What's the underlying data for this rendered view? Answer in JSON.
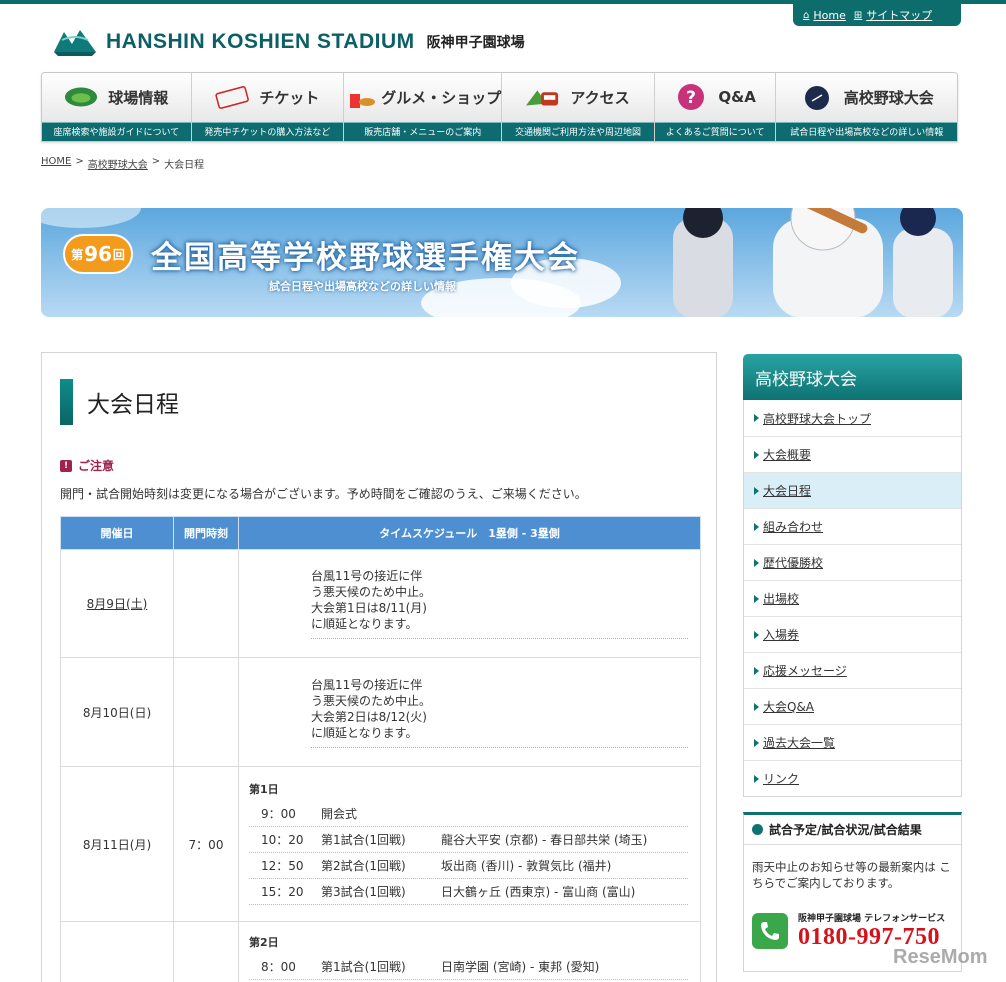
{
  "util": {
    "home": "Home",
    "sitemap": "サイトマップ"
  },
  "logo": {
    "en": "HANSHIN KOSHIEN STADIUM",
    "jp": "阪神甲子園球場"
  },
  "gnav": [
    {
      "label": "球場情報",
      "sub": "座席検索や施設ガイドについて"
    },
    {
      "label": "チケット",
      "sub": "発売中チケットの購入方法など"
    },
    {
      "label": "グルメ・ショップ",
      "sub": "販売店舗・メニューのご案内"
    },
    {
      "label": "アクセス",
      "sub": "交通機関ご利用方法や周辺地図"
    },
    {
      "label": "Q&A",
      "sub": "よくあるご質問について"
    },
    {
      "label": "高校野球大会",
      "sub": "試合日程や出場高校などの詳しい情報"
    }
  ],
  "breadcrumb": {
    "home": "HOME",
    "sep": ">",
    "parent": "高校野球大会",
    "current": "大会日程"
  },
  "banner": {
    "pre": "第",
    "num": "96",
    "post": "回",
    "title": "全国高等学校野球選手権大会",
    "subtitle": "試合日程や出場高校などの詳しい情報"
  },
  "page": {
    "title": "大会日程",
    "notice_title": "ご注意",
    "notice_text": "開門・試合開始時刻は変更になる場合がございます。予め時間をご確認のうえ、ご来場ください。"
  },
  "table": {
    "headers": [
      "開催日",
      "開門時刻",
      "タイムスケジュール　1塁側 - 3塁側"
    ],
    "rows": [
      {
        "date": "8月9日(土)",
        "gate": "",
        "lines": [
          "台風11号の接近に伴",
          "う悪天候のため中止。",
          "大会第1日は8/11(月)",
          "に順延となります。"
        ]
      },
      {
        "date": "8月10日(日)",
        "gate": "",
        "lines": [
          "台風11号の接近に伴",
          "う悪天候のため中止。",
          "大会第2日は8/12(火)",
          "に順延となります。"
        ]
      },
      {
        "date": "8月11日(月)",
        "gate": "7：00",
        "day": "第1日",
        "games": [
          {
            "time": "9：00",
            "game": "開会式",
            "match": ""
          },
          {
            "time": "10：20",
            "game": "第1試合(1回戦)",
            "match": "龍谷大平安 (京都) - 春日部共栄 (埼玉)"
          },
          {
            "time": "12：50",
            "game": "第2試合(1回戦)",
            "match": "坂出商 (香川) - 敦賀気比 (福井)"
          },
          {
            "time": "15：20",
            "game": "第3試合(1回戦)",
            "match": "日大鶴ヶ丘 (西東京) - 富山商 (富山)"
          }
        ]
      },
      {
        "date": "",
        "gate": "",
        "day": "第2日",
        "games": [
          {
            "time": "8：00",
            "game": "第1試合(1回戦)",
            "match": "日南学園 (宮崎) - 東邦 (愛知)"
          }
        ]
      }
    ]
  },
  "side": {
    "title": "高校野球大会",
    "items": [
      "高校野球大会トップ",
      "大会概要",
      "大会日程",
      "組み合わせ",
      "歴代優勝校",
      "出場校",
      "入場券",
      "応援メッセージ",
      "大会Q&A",
      "過去大会一覧",
      "リンク"
    ],
    "active_index": 2
  },
  "info": {
    "title": "試合予定/試合状況/試合結果",
    "text": "雨天中止のお知らせ等の最新案内は こちらでご案内しております。",
    "tel_label": "阪神甲子園球場 テレフォンサービス",
    "tel_number": "0180-997-750"
  },
  "watermark": "ReseMom"
}
